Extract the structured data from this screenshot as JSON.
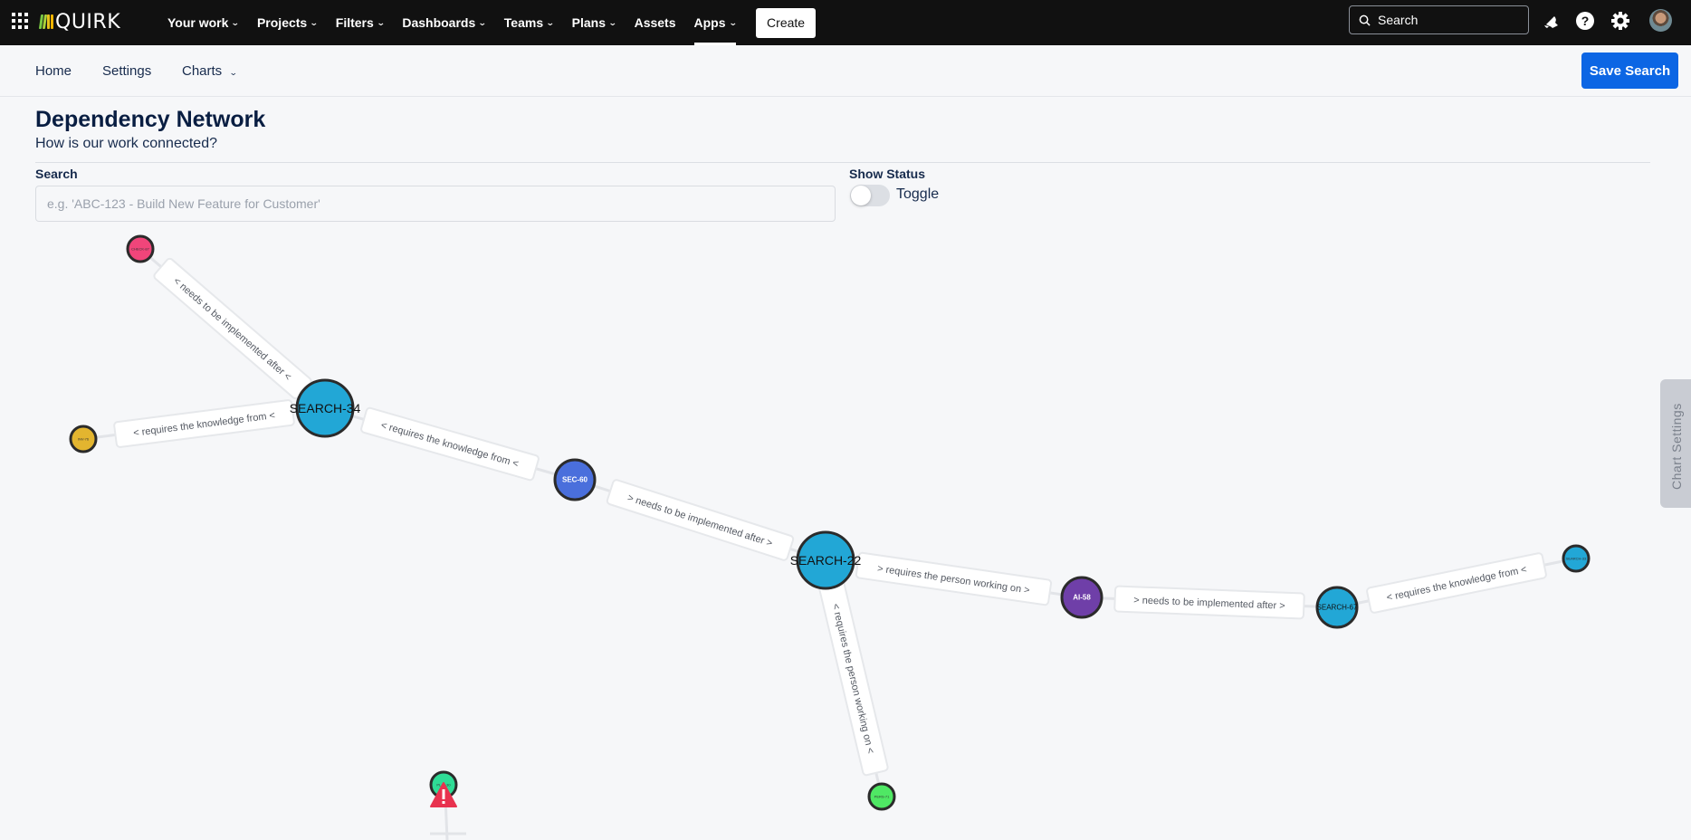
{
  "topbar": {
    "logo_text": "QUIRK",
    "logo_colors": [
      "#7ac943",
      "#a8d13a",
      "#e8c21a",
      "#f0b400"
    ],
    "nav": [
      {
        "label": "Your work",
        "dropdown": true
      },
      {
        "label": "Projects",
        "dropdown": true
      },
      {
        "label": "Filters",
        "dropdown": true
      },
      {
        "label": "Dashboards",
        "dropdown": true
      },
      {
        "label": "Teams",
        "dropdown": true
      },
      {
        "label": "Plans",
        "dropdown": true
      },
      {
        "label": "Assets",
        "dropdown": false
      },
      {
        "label": "Apps",
        "dropdown": true,
        "active": true
      }
    ],
    "create_label": "Create",
    "search_placeholder": "Search",
    "icons": [
      "notifications-icon",
      "help-icon",
      "settings-icon",
      "avatar"
    ]
  },
  "subnav": {
    "items": [
      {
        "label": "Home"
      },
      {
        "label": "Settings"
      },
      {
        "label": "Charts",
        "dropdown": true
      }
    ],
    "save_label": "Save Search"
  },
  "page": {
    "title": "Dependency Network",
    "subtitle": "How is our work connected?",
    "search_label": "Search",
    "search_placeholder": "e.g. 'ABC-123 - Build New Feature for Customer'",
    "search_value": "",
    "status_label": "Show Status",
    "toggle_label": "Toggle",
    "toggle_on": false,
    "chart_settings_label": "Chart Settings"
  },
  "graph": {
    "nodes": [
      {
        "id": "CHECK-87",
        "color": "#f0457a",
        "size": "small",
        "text_color": "#333333"
      },
      {
        "id": "INV-76",
        "color": "#e3b52f",
        "size": "small",
        "text_color": "#333333"
      },
      {
        "id": "SEARCH-34",
        "color": "#22a7d6",
        "size": "large",
        "text_color": "#111111"
      },
      {
        "id": "SEC-60",
        "color": "#4a6fdc",
        "size": "medium",
        "text_color": "#ffffff"
      },
      {
        "id": "SEARCH-22",
        "color": "#22a7d6",
        "size": "large",
        "text_color": "#111111"
      },
      {
        "id": "AI-58",
        "color": "#6f3fa8",
        "size": "medium",
        "text_color": "#ffffff"
      },
      {
        "id": "SEARCH-67",
        "color": "#22a7d6",
        "size": "medium",
        "text_color": "#111111"
      },
      {
        "id": "SEARCH-33",
        "color": "#22a7d6",
        "size": "small",
        "text_color": "#333333"
      },
      {
        "id": "PERS-71",
        "color": "#4fe864",
        "size": "small",
        "text_color": "#333333"
      },
      {
        "id": "PLAT-30",
        "color": "#2fdc96",
        "size": "small",
        "text_color": "#333333",
        "warning": true
      }
    ],
    "edges": [
      {
        "from": "CHECK-87",
        "to": "SEARCH-34",
        "label": "< needs to be implemented after <"
      },
      {
        "from": "INV-76",
        "to": "SEARCH-34",
        "label": "< requires the knowledge from <"
      },
      {
        "from": "SEARCH-34",
        "to": "SEC-60",
        "label": "< requires the knowledge from <"
      },
      {
        "from": "SEC-60",
        "to": "SEARCH-22",
        "label": "> needs to be implemented after >"
      },
      {
        "from": "SEARCH-22",
        "to": "AI-58",
        "label": "> requires the person working on >"
      },
      {
        "from": "AI-58",
        "to": "SEARCH-67",
        "label": "> needs to be implemented after >"
      },
      {
        "from": "SEARCH-67",
        "to": "SEARCH-33",
        "label": "< requires the knowledge from <"
      },
      {
        "from": "SEARCH-22",
        "to": "PERS-71",
        "label": "< requires the person working on <"
      }
    ]
  }
}
